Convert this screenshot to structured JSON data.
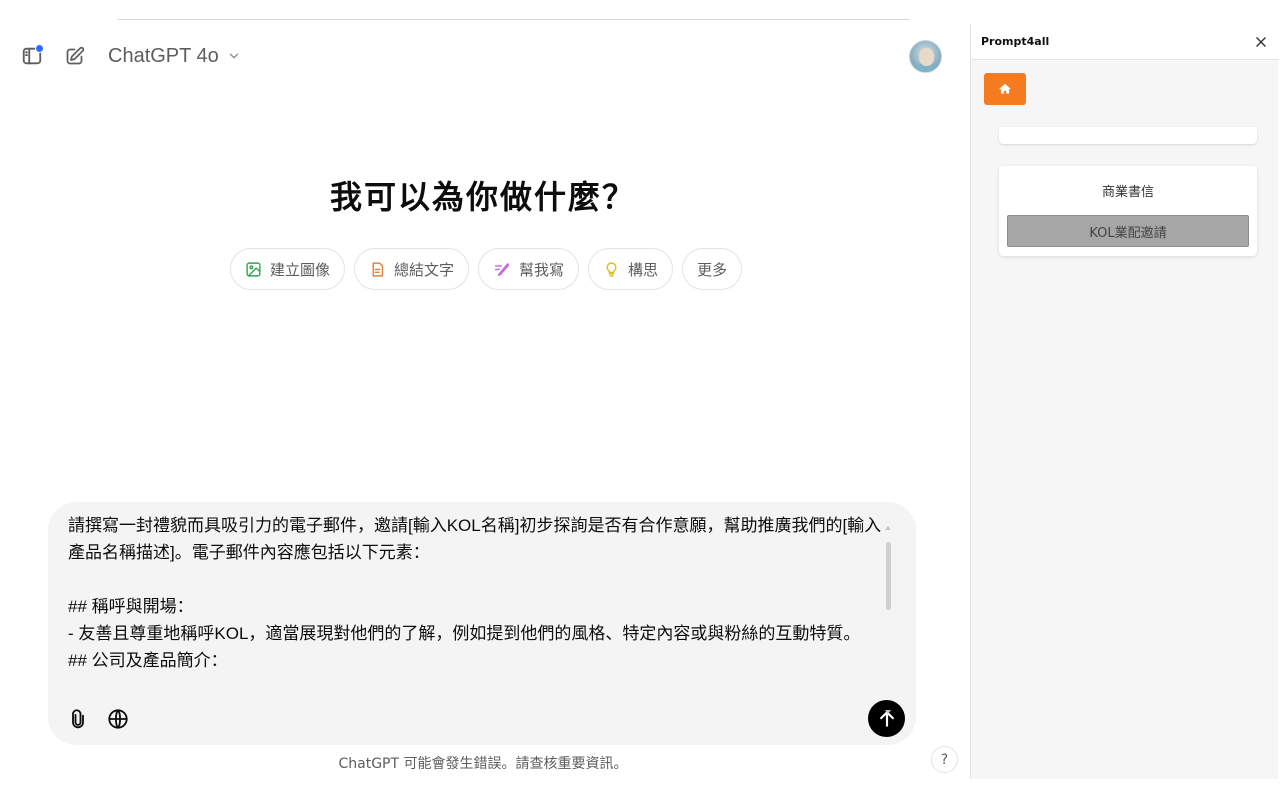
{
  "header": {
    "model_name": "ChatGPT 4o"
  },
  "main": {
    "headline": "我可以為你做什麼？",
    "chips": [
      {
        "label": "建立圖像",
        "icon": "image-icon",
        "color": "#2fa84f"
      },
      {
        "label": "總結文字",
        "icon": "document-icon",
        "color": "#e2803a"
      },
      {
        "label": "幫我寫",
        "icon": "pen-icon",
        "color": "#c56bd8"
      },
      {
        "label": "構思",
        "icon": "lightbulb-icon",
        "color": "#e8b923"
      },
      {
        "label": "更多",
        "icon": "",
        "color": ""
      }
    ]
  },
  "composer": {
    "text": "請撰寫一封禮貌而具吸引力的電子郵件，邀請[輸入KOL名稱]初步探詢是否有合作意願，幫助推廣我們的[輸入產品名稱描述]。電子郵件內容應包括以下元素：\n\n## 稱呼與開場：\n- 友善且尊重地稱呼KOL，適當展現對他們的了解，例如提到他們的風格、特定內容或與粉絲的互動特質。\n## 公司及產品簡介："
  },
  "footer": {
    "disclaimer": "ChatGPT 可能會發生錯誤。請查核重要資訊。",
    "help_label": "?"
  },
  "panel": {
    "title": "Prompt4all",
    "accent_color": "#f47b20",
    "items": [
      {
        "label": "商業書信"
      },
      {
        "label": "KOL業配邀請"
      }
    ]
  }
}
